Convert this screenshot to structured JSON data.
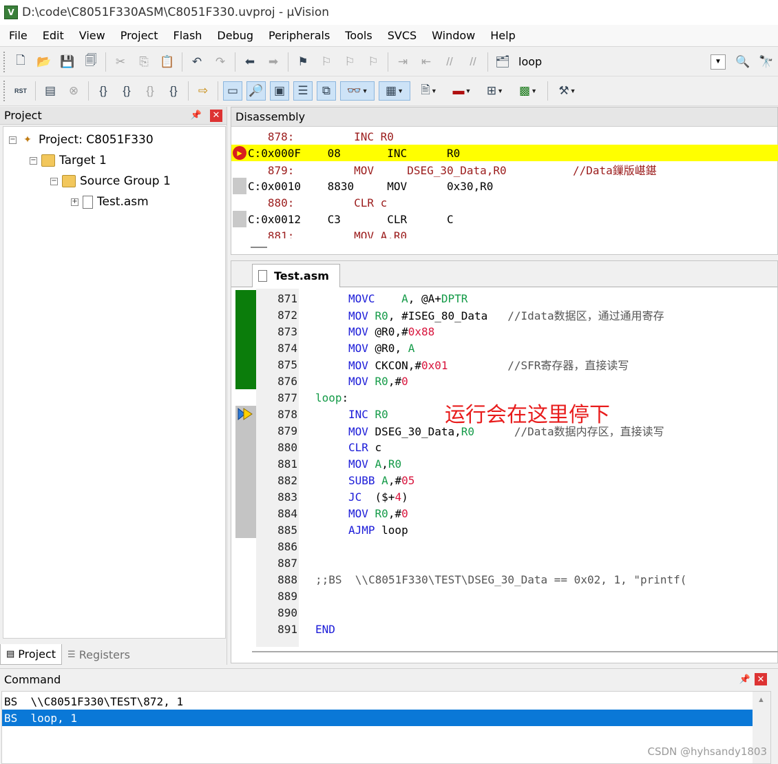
{
  "window": {
    "title": "D:\\code\\C8051F330ASM\\C8051F330.uvproj - µVision",
    "app_icon_letter": "V"
  },
  "menu": [
    "File",
    "Edit",
    "View",
    "Project",
    "Flash",
    "Debug",
    "Peripherals",
    "Tools",
    "SVCS",
    "Window",
    "Help"
  ],
  "toolbar": {
    "target_combo_value": "loop",
    "reset_label": "RST"
  },
  "project_panel": {
    "title": "Project",
    "tree": {
      "project": "Project: C8051F330",
      "target": "Target 1",
      "group": "Source Group 1",
      "file": "Test.asm"
    },
    "tabs": [
      "Project",
      "Registers"
    ]
  },
  "disassembly": {
    "title": "Disassembly",
    "rows": [
      {
        "kind": "src",
        "text": "   878:         INC R0"
      },
      {
        "kind": "cur",
        "text": "C:0x000F    08       INC      R0"
      },
      {
        "kind": "src",
        "text": "   879:         MOV     DSEG_30_Data,R0          //Data鏁版嵁鍖"
      },
      {
        "kind": "asm",
        "text": "C:0x0010    8830     MOV      0x30,R0"
      },
      {
        "kind": "src",
        "text": "   880:         CLR c"
      },
      {
        "kind": "asm",
        "text": "C:0x0012    C3       CLR      C"
      },
      {
        "kind": "src",
        "text": "   881:         MOV A,R0"
      }
    ]
  },
  "editor": {
    "tab_label": "Test.asm",
    "annotation": "运行会在这里停下",
    "lines": [
      {
        "n": "871",
        "code": [
          [
            "kw",
            "MOVC"
          ],
          [
            "",
            "    "
          ],
          [
            "reg",
            "A"
          ],
          [
            "",
            ", @A+"
          ],
          [
            "reg",
            "DPTR"
          ]
        ]
      },
      {
        "n": "872",
        "code": [
          [
            "kw",
            "MOV"
          ],
          [
            "",
            " "
          ],
          [
            "reg",
            "R0"
          ],
          [
            "",
            ", #ISEG_80_Data   "
          ],
          [
            "cmt",
            "//Idata数据区，通过通用寄存"
          ]
        ]
      },
      {
        "n": "873",
        "code": [
          [
            "kw",
            "MOV"
          ],
          [
            "",
            " @R0,#"
          ],
          [
            "num",
            "0x88"
          ]
        ]
      },
      {
        "n": "874",
        "code": [
          [
            "kw",
            "MOV"
          ],
          [
            "",
            " @R0, "
          ],
          [
            "reg",
            "A"
          ]
        ]
      },
      {
        "n": "875",
        "code": [
          [
            "kw",
            "MOV"
          ],
          [
            "",
            " CKCON,#"
          ],
          [
            "num",
            "0x01"
          ],
          [
            "",
            "         "
          ],
          [
            "cmt",
            "//SFR寄存器，直接读写"
          ]
        ]
      },
      {
        "n": "876",
        "code": [
          [
            "kw",
            "MOV"
          ],
          [
            "",
            " "
          ],
          [
            "reg",
            "R0"
          ],
          [
            "",
            ",#"
          ],
          [
            "num",
            "0"
          ]
        ]
      },
      {
        "n": "877",
        "code": [
          [
            "lbl",
            "loop"
          ],
          [
            "",
            ":"
          ]
        ],
        "label": true
      },
      {
        "n": "878",
        "code": [
          [
            "kw",
            "INC"
          ],
          [
            "",
            " "
          ],
          [
            "reg",
            "R0"
          ]
        ]
      },
      {
        "n": "879",
        "code": [
          [
            "kw",
            "MOV"
          ],
          [
            "",
            " DSEG_30_Data,"
          ],
          [
            "reg",
            "R0"
          ],
          [
            "",
            "      "
          ],
          [
            "cmt",
            "//Data数据内存区，直接读写"
          ]
        ]
      },
      {
        "n": "880",
        "code": [
          [
            "kw",
            "CLR"
          ],
          [
            "",
            " c"
          ]
        ]
      },
      {
        "n": "881",
        "code": [
          [
            "kw",
            "MOV"
          ],
          [
            "",
            " "
          ],
          [
            "reg",
            "A"
          ],
          [
            "",
            ","
          ],
          [
            "reg",
            "R0"
          ]
        ]
      },
      {
        "n": "882",
        "code": [
          [
            "kw",
            "SUBB"
          ],
          [
            "",
            " "
          ],
          [
            "reg",
            "A"
          ],
          [
            "",
            ",#"
          ],
          [
            "num",
            "05"
          ]
        ]
      },
      {
        "n": "883",
        "code": [
          [
            "kw",
            "JC"
          ],
          [
            "",
            "  ($+"
          ],
          [
            "num",
            "4"
          ],
          [
            "",
            ")"
          ]
        ]
      },
      {
        "n": "884",
        "code": [
          [
            "kw",
            "MOV"
          ],
          [
            "",
            " "
          ],
          [
            "reg",
            "R0"
          ],
          [
            "",
            ",#"
          ],
          [
            "num",
            "0"
          ]
        ]
      },
      {
        "n": "885",
        "code": [
          [
            "kw",
            "AJMP"
          ],
          [
            "",
            " loop"
          ]
        ]
      },
      {
        "n": "886",
        "code": []
      },
      {
        "n": "887",
        "code": []
      },
      {
        "n": "888",
        "code": [
          [
            "cmt",
            ";;BS  \\\\C8051F330\\TEST\\DSEG_30_Data == 0x02, 1, \"printf("
          ]
        ],
        "label": true
      },
      {
        "n": "889",
        "code": []
      },
      {
        "n": "890",
        "code": []
      },
      {
        "n": "891",
        "code": [
          [
            "kw",
            "END"
          ]
        ],
        "label": true
      }
    ]
  },
  "command": {
    "title": "Command",
    "lines": [
      {
        "text": "BS  \\\\C8051F330\\TEST\\872, 1",
        "selected": false
      },
      {
        "text": "BS  loop, 1",
        "selected": true
      }
    ],
    "watermark": "CSDN @hyhsandy1803"
  },
  "colors": {
    "current_line": "#ffff00",
    "keyword": "#1a1ad8",
    "register": "#139a47",
    "number": "#d8143c",
    "annotation": "#e81c1c",
    "selection": "#0a78d7"
  }
}
